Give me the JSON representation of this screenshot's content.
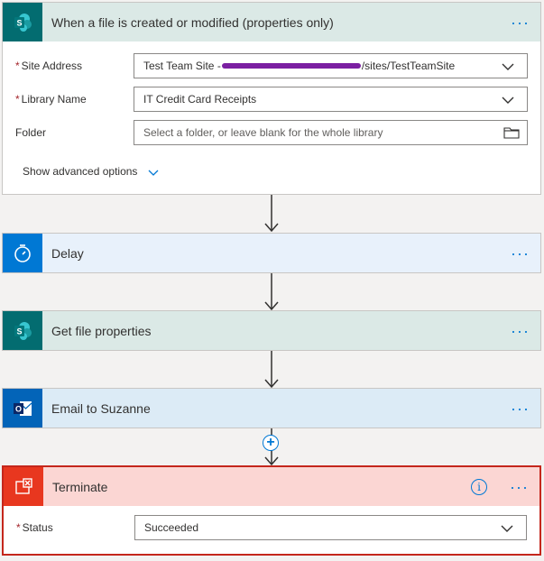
{
  "trigger": {
    "title": "When a file is created or modified (properties only)",
    "icon": "sharepoint-icon",
    "fields": [
      {
        "label": "Site Address",
        "required": true,
        "value": "Test Team Site - https://example.sharepoint.com/sites/TestTeamSite",
        "display_prefix": "Test Team Site - ",
        "display_suffix": "/sites/TestTeamSite"
      },
      {
        "label": "Library Name",
        "required": true,
        "value": "IT Credit Card Receipts"
      },
      {
        "label": "Folder",
        "required": false,
        "placeholder": "Select a folder, or leave blank for the whole library"
      }
    ],
    "advanced_label": "Show advanced options"
  },
  "steps": [
    {
      "title": "Delay",
      "icon": "timer-icon",
      "color": "#e8f1fb",
      "icon_bg": "#0078d4"
    },
    {
      "title": "Get file properties",
      "icon": "sharepoint-icon",
      "color": "#dbe9e6",
      "icon_bg": "#036c70"
    },
    {
      "title": "Email to Suzanne",
      "icon": "outlook-icon",
      "color": "#dcebf6",
      "icon_bg": "#0364b8"
    }
  ],
  "terminate": {
    "title": "Terminate",
    "icon": "terminate-icon",
    "field_label": "Status",
    "field_value": "Succeeded"
  },
  "colors": {
    "accent": "#0078d4",
    "terminate_bg": "#fbd6d3",
    "terminate_border": "#c4271c"
  }
}
